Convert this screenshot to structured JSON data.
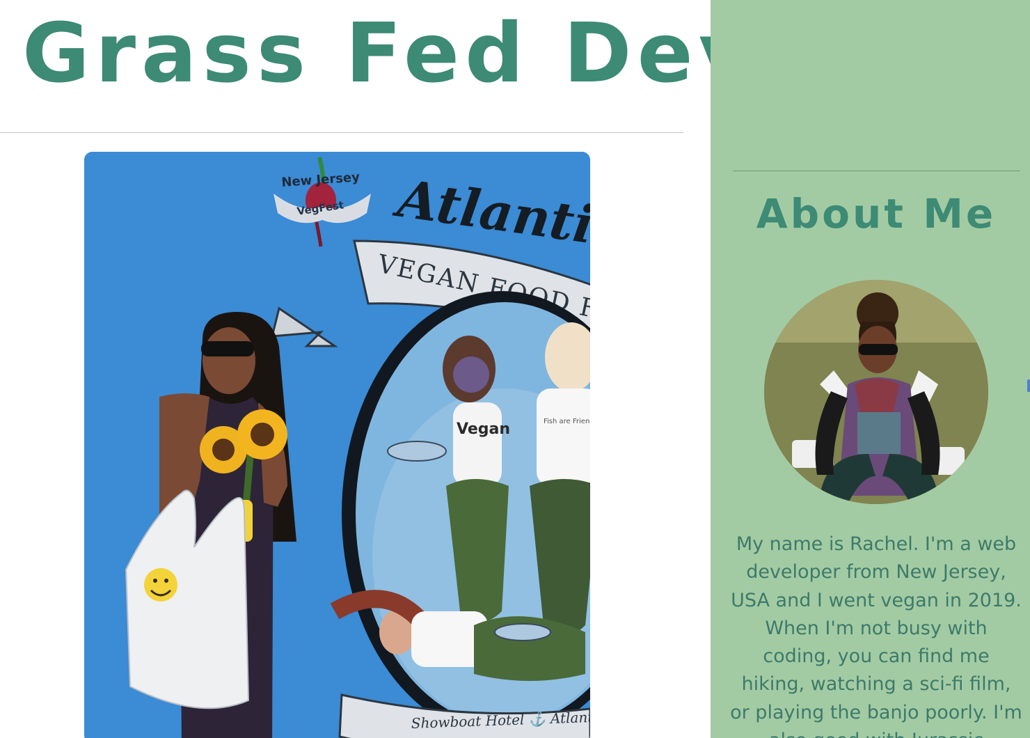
{
  "site": {
    "title": "Grass Fed Dev"
  },
  "main": {
    "featured_image": {
      "banner_top": "New Jersey",
      "banner_logo": "VegFest",
      "banner_title": "Atlantic C",
      "ribbon": "VEGAN FOOD FESTI",
      "shirt_text_1": "Vegan",
      "shirt_text_2": "Fish are Friends",
      "bottom_ribbon": "Showboat Hotel ⚓ Atlantic C"
    }
  },
  "sidebar": {
    "heading": "About Me",
    "bio": "My name is Rachel. I'm a web developer from New Jersey, USA and I went vegan in 2019. When I'm not busy with coding, you can find me hiking, watching a sci-fi film, or playing the banjo poorly. I'm also good with Jurassic"
  },
  "colors": {
    "brand_teal": "#3d8a75",
    "sidebar_green": "#a3cba3",
    "banner_blue": "#3f8fd8"
  },
  "icons": {
    "scroll": "scroll-indicator"
  }
}
